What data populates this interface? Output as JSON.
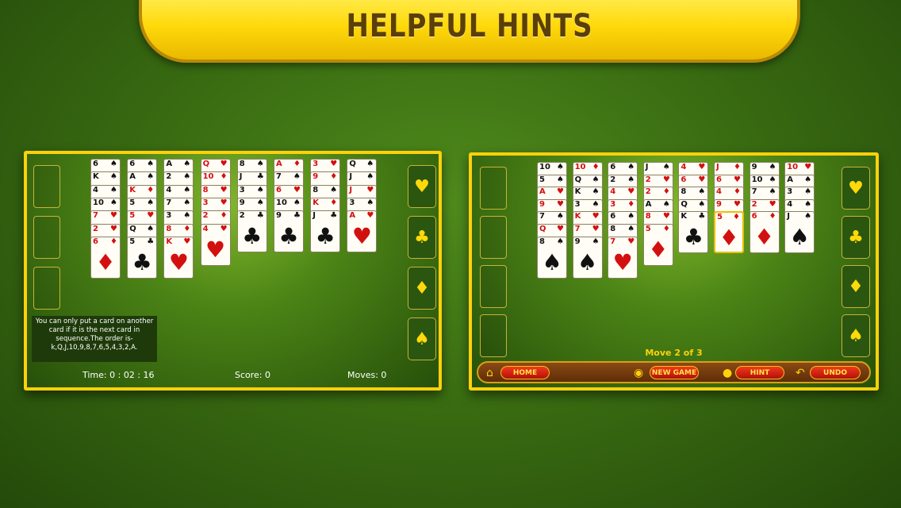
{
  "banner": {
    "title": "HELPFUL HINTS"
  },
  "colors": {
    "felt": "#3a6d12",
    "gold": "#ffd10a",
    "red_suit": "#d31010"
  },
  "left_panel": {
    "tip": "You can only put a card on another card if it is the next card in sequence.The order is-k,Q,J,10,9,8,7,6,5,4,3,2,A.",
    "time": "Time: 0 : 02 : 16",
    "score": "Score: 0",
    "moves": "Moves: 0",
    "foundations": [
      "heart",
      "club",
      "diamond",
      "spade"
    ],
    "columns": [
      [
        [
          "6",
          "s"
        ],
        [
          "K",
          "s"
        ],
        [
          "4",
          "s"
        ],
        [
          "10",
          "s"
        ],
        [
          "7",
          "h"
        ],
        [
          "2",
          "h"
        ],
        [
          "6",
          "d"
        ]
      ],
      [
        [
          "6",
          "s"
        ],
        [
          "A",
          "s"
        ],
        [
          "K",
          "d"
        ],
        [
          "5",
          "s"
        ],
        [
          "5",
          "h"
        ],
        [
          "Q",
          "s"
        ],
        [
          "5",
          "c"
        ]
      ],
      [
        [
          "A",
          "s"
        ],
        [
          "2",
          "s"
        ],
        [
          "4",
          "s"
        ],
        [
          "7",
          "s"
        ],
        [
          "3",
          "s"
        ],
        [
          "8",
          "d"
        ],
        [
          "K",
          "h"
        ]
      ],
      [
        [
          "Q",
          "h"
        ],
        [
          "10",
          "d"
        ],
        [
          "8",
          "h"
        ],
        [
          "3",
          "h"
        ],
        [
          "2",
          "d"
        ],
        [
          "4",
          "h"
        ]
      ],
      [
        [
          "8",
          "s"
        ],
        [
          "J",
          "c"
        ],
        [
          "3",
          "s"
        ],
        [
          "9",
          "s"
        ],
        [
          "2",
          "c"
        ]
      ],
      [
        [
          "A",
          "d"
        ],
        [
          "7",
          "s"
        ],
        [
          "6",
          "h"
        ],
        [
          "10",
          "s"
        ],
        [
          "9",
          "c"
        ]
      ],
      [
        [
          "3",
          "h"
        ],
        [
          "9",
          "d"
        ],
        [
          "8",
          "s"
        ],
        [
          "K",
          "d"
        ],
        [
          "J",
          "c"
        ]
      ],
      [
        [
          "Q",
          "s"
        ],
        [
          "J",
          "s"
        ],
        [
          "J",
          "h"
        ],
        [
          "3",
          "s"
        ],
        [
          "A",
          "h"
        ]
      ]
    ]
  },
  "right_panel": {
    "move_label": "Move 2 of 3",
    "toolbar": {
      "home": "HOME",
      "new_game": "NEW GAME",
      "hint": "HINT",
      "undo": "UNDO"
    },
    "foundations": [
      "heart",
      "club",
      "diamond",
      "spade"
    ],
    "columns": [
      [
        [
          "10",
          "s"
        ],
        [
          "5",
          "s"
        ],
        [
          "A",
          "h"
        ],
        [
          "9",
          "h"
        ],
        [
          "7",
          "s"
        ],
        [
          "Q",
          "h"
        ],
        [
          "8",
          "s"
        ]
      ],
      [
        [
          "10",
          "d"
        ],
        [
          "Q",
          "s"
        ],
        [
          "K",
          "s"
        ],
        [
          "3",
          "s"
        ],
        [
          "K",
          "h"
        ],
        [
          "7",
          "h"
        ],
        [
          "9",
          "s"
        ]
      ],
      [
        [
          "6",
          "s"
        ],
        [
          "2",
          "s"
        ],
        [
          "4",
          "h"
        ],
        [
          "3",
          "d"
        ],
        [
          "6",
          "s"
        ],
        [
          "8",
          "s"
        ],
        [
          "7",
          "h"
        ]
      ],
      [
        [
          "J",
          "s"
        ],
        [
          "2",
          "h"
        ],
        [
          "2",
          "d"
        ],
        [
          "A",
          "s"
        ],
        [
          "8",
          "h"
        ],
        [
          "5",
          "d"
        ]
      ],
      [
        [
          "4",
          "h"
        ],
        [
          "6",
          "h"
        ],
        [
          "8",
          "s"
        ],
        [
          "Q",
          "s"
        ],
        [
          "K",
          "c"
        ]
      ],
      [
        [
          "J",
          "d"
        ],
        [
          "6",
          "h"
        ],
        [
          "4",
          "d"
        ],
        [
          "9",
          "h"
        ],
        [
          "5",
          "d"
        ]
      ],
      [
        [
          "9",
          "s"
        ],
        [
          "10",
          "s"
        ],
        [
          "7",
          "s"
        ],
        [
          "2",
          "h"
        ],
        [
          "6",
          "d"
        ]
      ],
      [
        [
          "10",
          "h"
        ],
        [
          "A",
          "s"
        ],
        [
          "3",
          "s"
        ],
        [
          "4",
          "s"
        ],
        [
          "J",
          "s"
        ]
      ]
    ]
  }
}
